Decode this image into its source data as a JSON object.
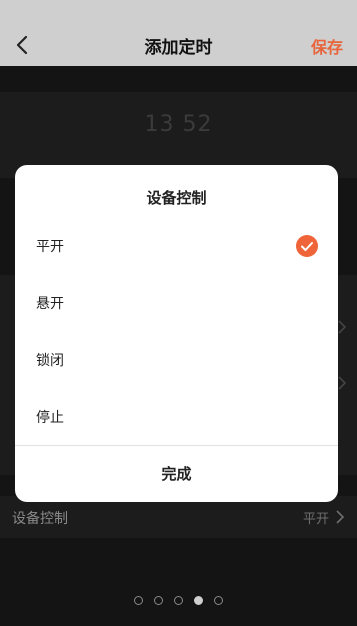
{
  "header": {
    "title": "添加定时",
    "save_label": "保存"
  },
  "background": {
    "time_hour": "13",
    "time_minute": "52",
    "device_row_label": "设备控制",
    "device_row_value": "平开"
  },
  "dialog": {
    "title": "设备控制",
    "options": [
      {
        "label": "平开",
        "selected": true
      },
      {
        "label": "悬开",
        "selected": false
      },
      {
        "label": "锁闭",
        "selected": false
      },
      {
        "label": "停止",
        "selected": false
      }
    ],
    "done_label": "完成"
  },
  "pager": {
    "count": 5,
    "active_index": 3
  },
  "colors": {
    "accent": "#e8643a",
    "check": "#f0643a"
  }
}
